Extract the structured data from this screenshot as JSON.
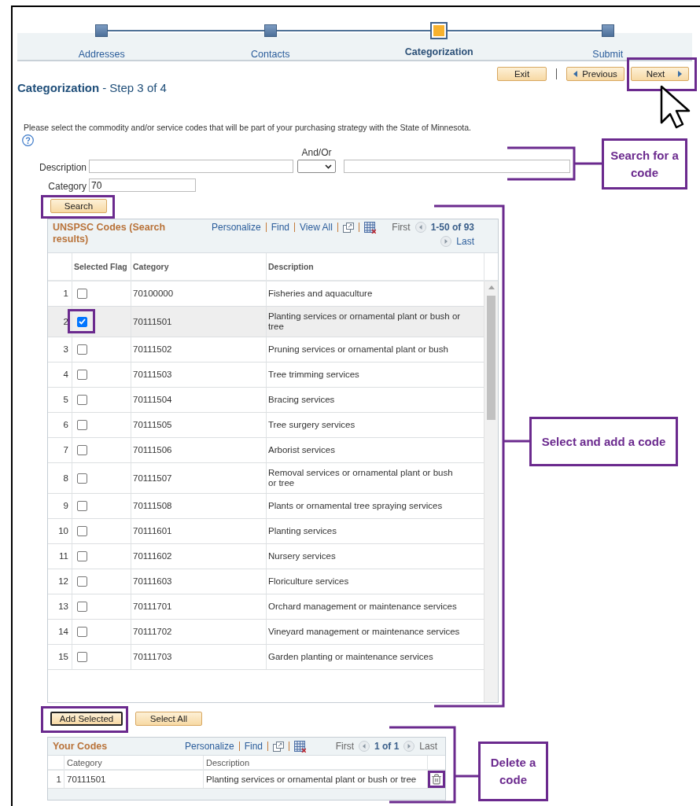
{
  "progress": {
    "steps": [
      {
        "label": "Addresses",
        "selected": false
      },
      {
        "label": "Contacts",
        "selected": false
      },
      {
        "label": "Categorization",
        "selected": true
      },
      {
        "label": "Submit",
        "selected": false
      }
    ]
  },
  "toolbar_buttons": [
    {
      "label": "Exit",
      "kind": "plain",
      "highlighted": false
    },
    {
      "label": "Previous",
      "kind": "back",
      "highlighted": false
    },
    {
      "label": "Next",
      "kind": "forward",
      "highlighted": true
    }
  ],
  "page_title": {
    "title": "Categorization",
    "step": "- Step 3 of 4"
  },
  "instructions": "Please select the commodity and/or service codes that will be part of your purchasing strategy with the State of Minnesota.",
  "search_form": {
    "description_label": "Description",
    "and_or_label": "And/Or",
    "category_label": "Category",
    "category_value": "70",
    "search_button": {
      "label": "Search",
      "highlighted": true
    }
  },
  "results_grid": {
    "title": "UNSPSC Codes (Search results)",
    "links": [
      "Personalize",
      "Find",
      "View All"
    ],
    "first": "First",
    "range": "1-50 of 93",
    "last": "Last",
    "columns": [
      "Selected Flag",
      "Category",
      "Description"
    ],
    "rows": [
      {
        "number": "1",
        "checked": false,
        "selected": false,
        "highlighted": false,
        "category": "70100000",
        "description": "Fisheries and aquaculture"
      },
      {
        "number": "2",
        "checked": true,
        "selected": true,
        "highlighted": true,
        "category": "70111501",
        "description": "Planting services or ornamental plant or bush or tree"
      },
      {
        "number": "3",
        "checked": false,
        "selected": false,
        "highlighted": false,
        "category": "70111502",
        "description": "Pruning services or ornamental plant or bush"
      },
      {
        "number": "4",
        "checked": false,
        "selected": false,
        "highlighted": false,
        "category": "70111503",
        "description": "Tree trimming services"
      },
      {
        "number": "5",
        "checked": false,
        "selected": false,
        "highlighted": false,
        "category": "70111504",
        "description": "Bracing services"
      },
      {
        "number": "6",
        "checked": false,
        "selected": false,
        "highlighted": false,
        "category": "70111505",
        "description": "Tree surgery services"
      },
      {
        "number": "7",
        "checked": false,
        "selected": false,
        "highlighted": false,
        "category": "70111506",
        "description": "Arborist services"
      },
      {
        "number": "8",
        "checked": false,
        "selected": false,
        "highlighted": false,
        "category": "70111507",
        "description": "Removal services or ornamental plant or bush or tree"
      },
      {
        "number": "9",
        "checked": false,
        "selected": false,
        "highlighted": false,
        "category": "70111508",
        "description": "Plants or ornamental tree spraying services"
      },
      {
        "number": "10",
        "checked": false,
        "selected": false,
        "highlighted": false,
        "category": "70111601",
        "description": "Planting services"
      },
      {
        "number": "11",
        "checked": false,
        "selected": false,
        "highlighted": false,
        "category": "70111602",
        "description": "Nursery services"
      },
      {
        "number": "12",
        "checked": false,
        "selected": false,
        "highlighted": false,
        "category": "70111603",
        "description": "Floriculture services"
      },
      {
        "number": "13",
        "checked": false,
        "selected": false,
        "highlighted": false,
        "category": "70111701",
        "description": "Orchard management or maintenance services"
      },
      {
        "number": "14",
        "checked": false,
        "selected": false,
        "highlighted": false,
        "category": "70111702",
        "description": "Vineyard management or maintenance services"
      },
      {
        "number": "15",
        "checked": false,
        "selected": false,
        "highlighted": false,
        "category": "70111703",
        "description": "Garden planting or maintenance services"
      }
    ]
  },
  "actions": [
    {
      "label": "Add Selected",
      "highlighted": true
    },
    {
      "label": "Select All",
      "highlighted": false
    }
  ],
  "your_codes": {
    "title": "Your Codes",
    "links": [
      "Personalize",
      "Find"
    ],
    "first": "First",
    "range": "1 of 1",
    "last": "Last",
    "columns": [
      "Category",
      "Description"
    ],
    "rows": [
      {
        "number": "1",
        "category": "70111501",
        "description": "Planting services or ornamental plant or bush or tree",
        "highlighted": true
      }
    ]
  },
  "annotations": [
    {
      "text": "Search for a code"
    },
    {
      "text": "Select and add a code"
    },
    {
      "text": "Delete a code"
    }
  ]
}
